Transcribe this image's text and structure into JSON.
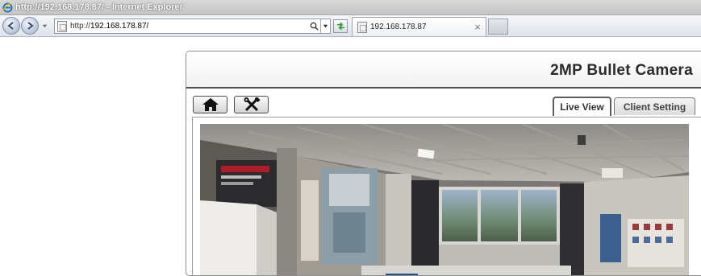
{
  "window": {
    "title": "http://192.168.178.87/ - Internet Explorer"
  },
  "navbar": {
    "address_prefix": "http://",
    "address_host": "192.168.178.87/",
    "tab_label": "192.168.178.87",
    "tab_close": "×"
  },
  "page": {
    "product_title": "2MP Bullet Camera",
    "tabs": [
      {
        "label": "Live View",
        "active": true
      },
      {
        "label": "Client Setting",
        "active": false
      }
    ],
    "buttons": {
      "home": "home-icon",
      "tools": "tools-icon"
    }
  },
  "colors": {
    "header_rule": "#4e4e4e",
    "ie_blue": "#1e73be"
  }
}
